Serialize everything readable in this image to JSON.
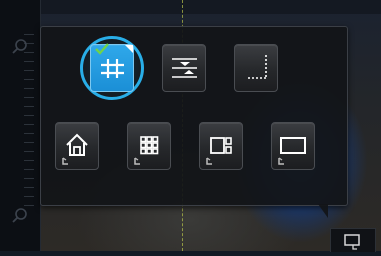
{
  "colors": {
    "accent": "#29aee8",
    "selected_fill": "#1b8fd6",
    "check": "#6fd34a",
    "guide": "#b7c24a",
    "tile_bg": "#2a2c30",
    "icon": "#ffffff"
  },
  "grid_menu": {
    "row1": [
      {
        "icon": "grid-hash-icon",
        "selected": true
      },
      {
        "icon": "horizontal-guides-icon",
        "selected": false
      },
      {
        "icon": "corner-measure-icon",
        "selected": false
      }
    ],
    "row2": [
      {
        "icon": "home-icon",
        "has_submenu": true
      },
      {
        "icon": "grid-3x3-icon",
        "has_submenu": true
      },
      {
        "icon": "split-layout-icon",
        "has_submenu": true
      },
      {
        "icon": "frame-rectangle-icon",
        "has_submenu": true
      }
    ]
  }
}
